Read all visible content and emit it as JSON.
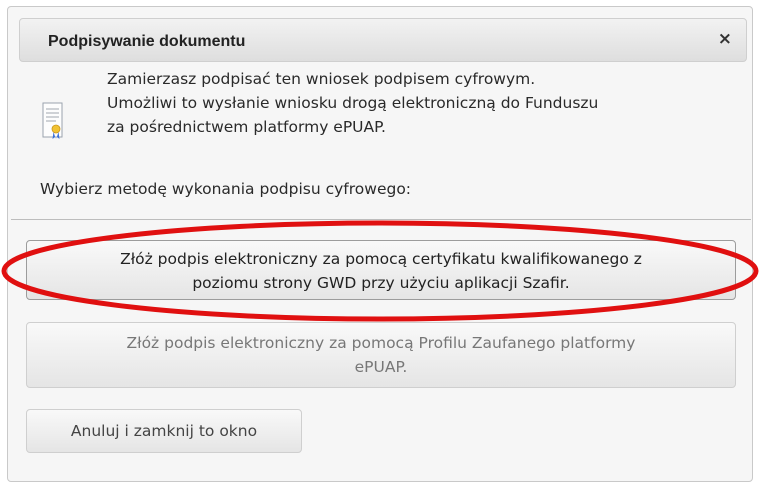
{
  "dialog": {
    "title": "Podpisywanie dokumentu",
    "close_symbol": "×",
    "icon": "certificate-document-icon",
    "info_lines": [
      "Zamierzasz podpisać ten wniosek podpisem cyfrowym.",
      "Umożliwi to wysłanie wniosku drogą elektroniczną do Funduszu",
      "za pośrednictwem platformy ePUAP."
    ],
    "choose_label": "Wybierz metodę wykonania podpisu cyfrowego:",
    "buttons": {
      "szafir": [
        "Złóż podpis elektroniczny za pomocą certyfikatu kwalifikowanego z",
        "poziomu strony GWD przy użyciu aplikacji Szafir."
      ],
      "epuap": [
        "Złóż podpis elektroniczny za pomocą Profilu Zaufanego platformy",
        "ePUAP."
      ],
      "cancel": "Anuluj i zamknij to okno"
    }
  },
  "colors": {
    "highlight": "#e01010",
    "titlebar_top": "#f2f2f2",
    "titlebar_bottom": "#dedede",
    "dialog_bg": "#f6f6f6"
  }
}
